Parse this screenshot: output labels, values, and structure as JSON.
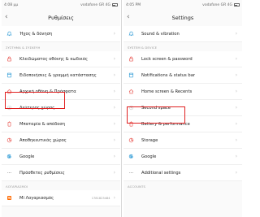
{
  "left": {
    "status": {
      "time": "4:08 μμ",
      "carrier": "vodafone GR 4G"
    },
    "title": "Ρυθμίσεις",
    "top_items": [
      {
        "label": "Ήχος & δόνηση",
        "icon": "bell-icon",
        "color": "#2e9bd6"
      }
    ],
    "section_system": "ΣΥΣΤΗΜΑ & ΣΥΣΚΕΥΗ",
    "system_items": [
      {
        "label": "Κλειδώματος οθόνης & κωδικός",
        "icon": "lock-icon",
        "color": "#e8504a"
      },
      {
        "label": "Ειδοποιήσεις & γραμμή κατάστασης",
        "icon": "notification-icon",
        "color": "#2e9bd6"
      },
      {
        "label": "Αρχική οθόνη & Πρόσφατα",
        "icon": "home-icon",
        "color": "#e8504a"
      },
      {
        "label": "Δεύτερος χώρος",
        "icon": "second-space-icon",
        "color": "#cccccc"
      },
      {
        "label": "Μπαταρία & απόδοση",
        "icon": "battery-icon",
        "color": "#e8504a"
      },
      {
        "label": "Αποθηκευτικός χώρος",
        "icon": "storage-icon",
        "color": "#e8504a"
      },
      {
        "label": "Google",
        "icon": "google-icon",
        "color": "#2e9bd6"
      },
      {
        "label": "Πρόσθετες ρυθμίσεις",
        "icon": "more-icon",
        "color": "#999999"
      }
    ],
    "section_accounts": "ΛΟΓΑΡΙΑΣΜΟΙ",
    "account_items": [
      {
        "label": "Mi Λογαριασμός",
        "icon": "mi-account-icon",
        "color": "#ff6a00",
        "aux": "1781823484"
      }
    ]
  },
  "right": {
    "status": {
      "time": "4:05 PM",
      "carrier": "vodafone GR 4G"
    },
    "title": "Settings",
    "top_items": [
      {
        "label": "Sound & vibration",
        "icon": "bell-icon",
        "color": "#2e9bd6"
      }
    ],
    "section_system": "SYSTEM & DEVICE",
    "system_items": [
      {
        "label": "Lock screen & password",
        "icon": "lock-icon",
        "color": "#e8504a"
      },
      {
        "label": "Notifications & status bar",
        "icon": "notification-icon",
        "color": "#2e9bd6"
      },
      {
        "label": "Home screen & Recents",
        "icon": "home-icon",
        "color": "#e8504a"
      },
      {
        "label": "Second space",
        "icon": "second-space-icon",
        "color": "#cccccc"
      },
      {
        "label": "Battery & performance",
        "icon": "battery-icon",
        "color": "#e8504a"
      },
      {
        "label": "Storage",
        "icon": "storage-icon",
        "color": "#e8504a"
      },
      {
        "label": "Google",
        "icon": "google-icon",
        "color": "#2e9bd6"
      },
      {
        "label": "Additional settings",
        "icon": "more-icon",
        "color": "#999999"
      }
    ],
    "section_accounts": "ACCOUNTS",
    "account_items": []
  },
  "highlight_color": "#e02020"
}
